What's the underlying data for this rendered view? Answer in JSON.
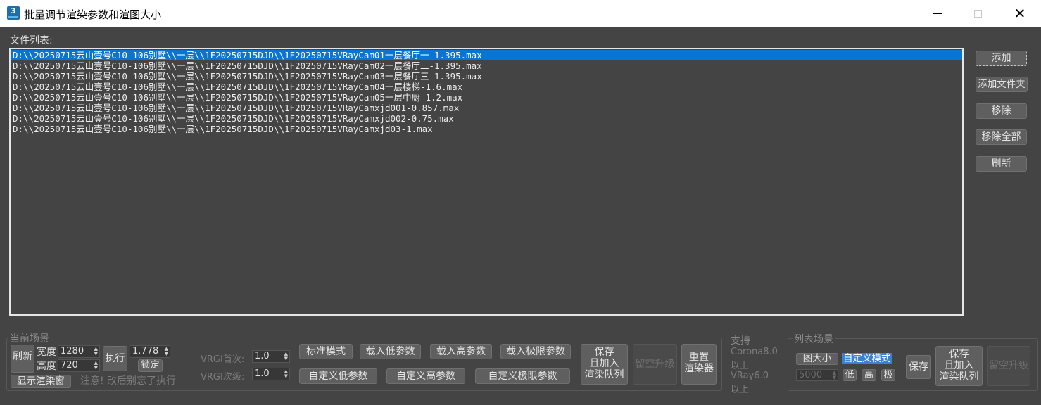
{
  "window": {
    "title": "批量调节渲染参数和渲图大小",
    "app_icon_text": "3",
    "minimize_icon": "minimize-icon",
    "maximize_icon": "maximize-icon",
    "close_icon": "close-icon"
  },
  "file_list": {
    "label": "文件列表:",
    "items": [
      "D:\\\\20250715云山壹号C10-106别墅\\\\一层\\\\1F20250715DJD\\\\1F20250715VRayCam01一层餐厅一-1.395.max",
      "D:\\\\20250715云山壹号C10-106别墅\\\\一层\\\\1F20250715DJD\\\\1F20250715VRayCam02一层餐厅二-1.395.max",
      "D:\\\\20250715云山壹号C10-106别墅\\\\一层\\\\1F20250715DJD\\\\1F20250715VRayCam03一层餐厅三-1.395.max",
      "D:\\\\20250715云山壹号C10-106别墅\\\\一层\\\\1F20250715DJD\\\\1F20250715VRayCam04一层楼梯-1.6.max",
      "D:\\\\20250715云山壹号C10-106别墅\\\\一层\\\\1F20250715DJD\\\\1F20250715VRayCam05一层中厨-1.2.max",
      "D:\\\\20250715云山壹号C10-106别墅\\\\一层\\\\1F20250715DJD\\\\1F20250715VRayCamxjd001-0.857.max",
      "D:\\\\20250715云山壹号C10-106别墅\\\\一层\\\\1F20250715DJD\\\\1F20250715VRayCamxjd002-0.75.max",
      "D:\\\\20250715云山壹号C10-106别墅\\\\一层\\\\1F20250715DJD\\\\1F20250715VRayCamxjd03-1.max"
    ],
    "selected_index": 0
  },
  "side_buttons": {
    "add": "添加",
    "add_folder": "添加文件夹",
    "remove": "移除",
    "remove_all": "移除全部",
    "refresh": "刷新"
  },
  "current_scene": {
    "group_label": "当前场景",
    "refresh": "刷新",
    "width_label": "宽度",
    "width_value": "1280",
    "height_label": "高度",
    "height_value": "720",
    "execute": "执行",
    "ratio_value": "1.778",
    "lock": "锁定",
    "show_render_window": "显示渲染窗",
    "notice": "注意! 改后别忘了执行"
  },
  "vray": {
    "primary_label": "VRGI首次:",
    "primary_value": "1.0",
    "secondary_label": "VRGI次级:",
    "secondary_value": "1.0"
  },
  "presets": {
    "standard": "标准模式",
    "load_low": "载入低参数",
    "load_high": "载入高参数",
    "load_limit": "载入极限参数",
    "custom_low": "自定义低参数",
    "custom_high": "自定义高参数",
    "custom_limit": "自定义极限参数",
    "save_queue_1": "保存",
    "save_queue_2": "且加入",
    "save_queue_3": "渲染队列",
    "reserve_upgrade": "留空升级",
    "reset_renderer_1": "重置",
    "reset_renderer_2": "渲染器"
  },
  "support": {
    "title": "支持",
    "line1": "Corona8.0",
    "line2": "以上",
    "line3": "VRay6.0",
    "line4": "以上"
  },
  "list_scene": {
    "group_label": "列表场景",
    "image_size": "图大小",
    "custom_mode": "自定义模式",
    "value": "5000",
    "low": "低",
    "high": "高",
    "limit": "极",
    "save": "保存",
    "save_queue_1": "保存",
    "save_queue_2": "且加入",
    "save_queue_3": "渲染队列",
    "reserve_upgrade": "留空升级"
  }
}
